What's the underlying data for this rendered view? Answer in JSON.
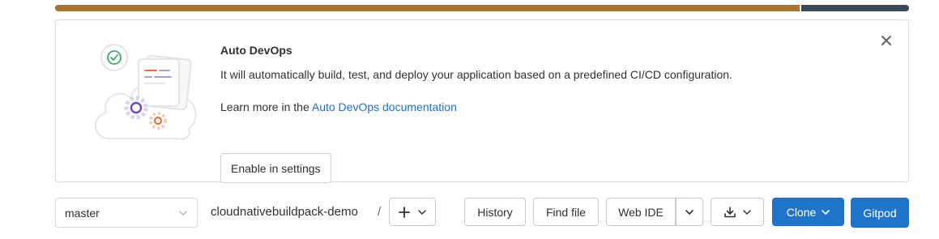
{
  "progress": {
    "fraction": 0.872
  },
  "banner": {
    "title": "Auto DevOps",
    "description": "It will automatically build, test, and deploy your application based on a predefined CI/CD configuration.",
    "learn_more_prefix": "Learn more in the ",
    "learn_more_link": "Auto DevOps documentation",
    "enable_button": "Enable in settings",
    "close_icon": "close-icon",
    "illustration_icon": "auto-devops-illustration"
  },
  "toolbar": {
    "branch": "master",
    "project": "cloudnativebuildpack-demo",
    "separator": "/",
    "add_icon": "plus-icon",
    "history": "History",
    "find_file": "Find file",
    "web_ide": "Web IDE",
    "download_icon": "download-icon",
    "clone": "Clone",
    "gitpod": "Gitpod"
  },
  "colors": {
    "progress_fill": "#a97531",
    "progress_track": "#3a4a55",
    "link": "#1f6fc5",
    "primary": "#1f75cb"
  }
}
